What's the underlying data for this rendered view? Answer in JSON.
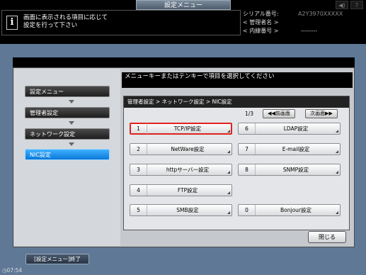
{
  "header": {
    "title": "設定メニュー",
    "message": "画面に表示される項目に応じて\n設定を行って下さい",
    "serial_label": "シリアル番号:",
    "serial_value": "A2Y3970XXXXX",
    "admin_label": "< 管理者名 >",
    "extension_label": "< 内線番号 >",
    "extension_value": "--------",
    "icons": [
      "speaker-icon",
      "help-icon"
    ]
  },
  "sidebar": {
    "items": [
      {
        "label": "設定メニュー",
        "active": false
      },
      {
        "label": "管理者設定",
        "active": false
      },
      {
        "label": "ネットワーク設定",
        "active": false
      },
      {
        "label": "NIC設定",
        "active": true
      }
    ]
  },
  "main": {
    "instruction": "メニューキーまたはテンキーで項目を選択してください",
    "breadcrumb": "管理者設定 > ネットワーク設定 > NIC設定",
    "page": "1/3",
    "prev_label": "◀◀前画面",
    "next_label": "次画面▶▶",
    "items": [
      {
        "num": "1",
        "label": "TCP/IP設定",
        "selected": true
      },
      {
        "num": "2",
        "label": "NetWare設定",
        "selected": false
      },
      {
        "num": "3",
        "label": "httpサーバー設定",
        "selected": false
      },
      {
        "num": "4",
        "label": "FTP設定",
        "selected": false
      },
      {
        "num": "5",
        "label": "SMB設定",
        "selected": false
      },
      {
        "num": "6",
        "label": "LDAP設定",
        "selected": false
      },
      {
        "num": "7",
        "label": "E-mail設定",
        "selected": false
      },
      {
        "num": "8",
        "label": "SNMP設定",
        "selected": false
      },
      {
        "num": "0",
        "label": "Bonjour設定",
        "selected": false
      }
    ],
    "close_label": "閉じる"
  },
  "footer": {
    "end_label": "[設定メニュー]終了",
    "clock": "07:54"
  },
  "colors": {
    "frame": "#5f7896",
    "active_tab": "#1a8ef0",
    "selected_border": "#e0221f"
  }
}
